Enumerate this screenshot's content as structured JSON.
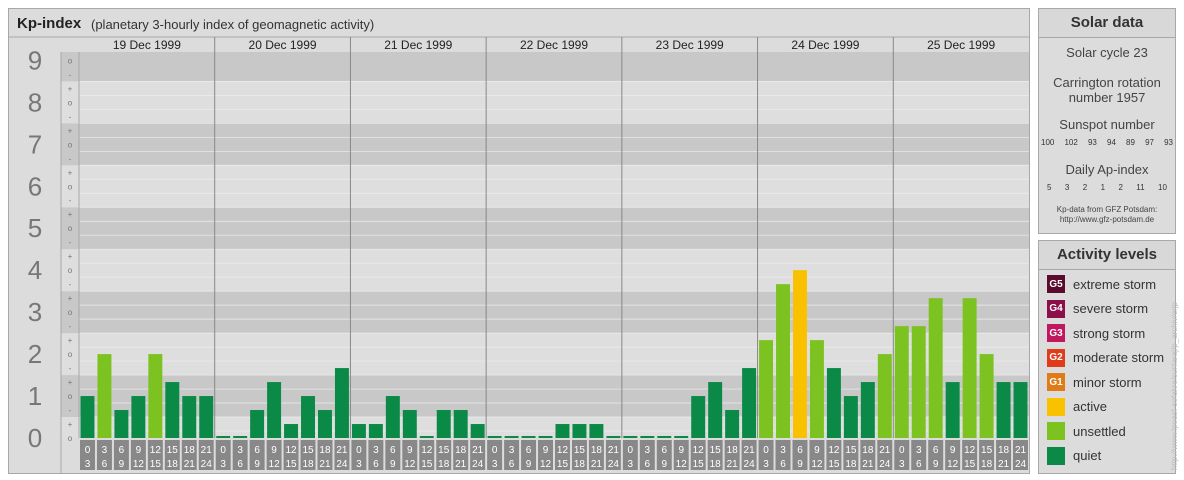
{
  "header": {
    "title": "Kp-index",
    "subtitle": "(planetary 3-hourly index of geomagnetic activity)"
  },
  "chart_data": {
    "type": "bar",
    "title": "Kp-index",
    "subtitle": "(planetary 3-hourly index of geomagnetic activity)",
    "days": [
      "19 Dec 1999",
      "20 Dec 1999",
      "21 Dec 1999",
      "22 Dec 1999",
      "23 Dec 1999",
      "24 Dec 1999",
      "25 Dec 1999"
    ],
    "ylim": [
      0,
      9
    ],
    "y_ticks": [
      "0",
      "1",
      "2",
      "3",
      "4",
      "5",
      "6",
      "7",
      "8",
      "9"
    ],
    "y_minor_labels": [
      "+",
      "o",
      "-"
    ],
    "interval_top": [
      "0",
      "3",
      "6",
      "9",
      "12",
      "15",
      "18",
      "21"
    ],
    "interval_bottom": [
      "3",
      "6",
      "9",
      "12",
      "15",
      "18",
      "21",
      "24"
    ],
    "values": [
      [
        1.0,
        2.0,
        0.667,
        1.0,
        2.0,
        1.333,
        1.0,
        1.0
      ],
      [
        0.0,
        0.0,
        0.667,
        1.333,
        0.333,
        1.0,
        0.667,
        1.667
      ],
      [
        0.333,
        0.333,
        1.0,
        0.667,
        0.0,
        0.667,
        0.667,
        0.333
      ],
      [
        0.0,
        0.0,
        0.0,
        0.0,
        0.333,
        0.333,
        0.333,
        0.0
      ],
      [
        0.0,
        0.0,
        0.0,
        0.0,
        1.0,
        1.333,
        0.667,
        1.667
      ],
      [
        2.333,
        3.667,
        4.0,
        2.333,
        1.667,
        1.0,
        1.333,
        2.0
      ],
      [
        2.667,
        2.667,
        3.333,
        1.333,
        3.333,
        2.0,
        1.333,
        1.333
      ]
    ],
    "grid": true,
    "colors": {
      "quiet": "#0a8a46",
      "unsettled": "#7cc321",
      "active": "#f9c100",
      "g1": "#e07b1a",
      "g2": "#e03c1a",
      "g3": "#c0175e",
      "g4": "#8c0f4c",
      "g5": "#5a0a2e",
      "band_dark": "#c8c8c8",
      "band_light": "#dedede",
      "axis_bg": "#dcdcdc",
      "label_box": "#888888",
      "tick_text": "#777777"
    }
  },
  "solar": {
    "title": "Solar data",
    "cycle": "Solar cycle 23",
    "carrington_1": "Carrington rotation",
    "carrington_2": "number 1957",
    "sunspot_title": "Sunspot number",
    "sunspot_values": [
      "100",
      "102",
      "93",
      "94",
      "89",
      "97",
      "93"
    ],
    "ap_title": "Daily Ap-index",
    "ap_values": [
      "5",
      "3",
      "2",
      "1",
      "2",
      "11",
      "10"
    ],
    "source_1": "Kp-data from GFZ Potsdam:",
    "source_2": "http://www.gfz-potsdam.de"
  },
  "activity": {
    "title": "Activity levels",
    "levels": [
      {
        "code": "G5",
        "label": "extreme storm",
        "color": "#5a0a2e"
      },
      {
        "code": "G4",
        "label": "severe storm",
        "color": "#8c0f4c"
      },
      {
        "code": "G3",
        "label": "strong storm",
        "color": "#c0175e"
      },
      {
        "code": "G2",
        "label": "moderate storm",
        "color": "#e03c1a"
      },
      {
        "code": "G1",
        "label": "minor storm",
        "color": "#e07b1a"
      },
      {
        "code": "",
        "label": "active",
        "color": "#f9c100"
      },
      {
        "code": "",
        "label": "unsettled",
        "color": "#7cc321"
      },
      {
        "code": "",
        "label": "quiet",
        "color": "#0a8a46"
      }
    ]
  },
  "watermark": "http://www.tpoast-sofakre/sunlaraj/p_archiv/erjp"
}
